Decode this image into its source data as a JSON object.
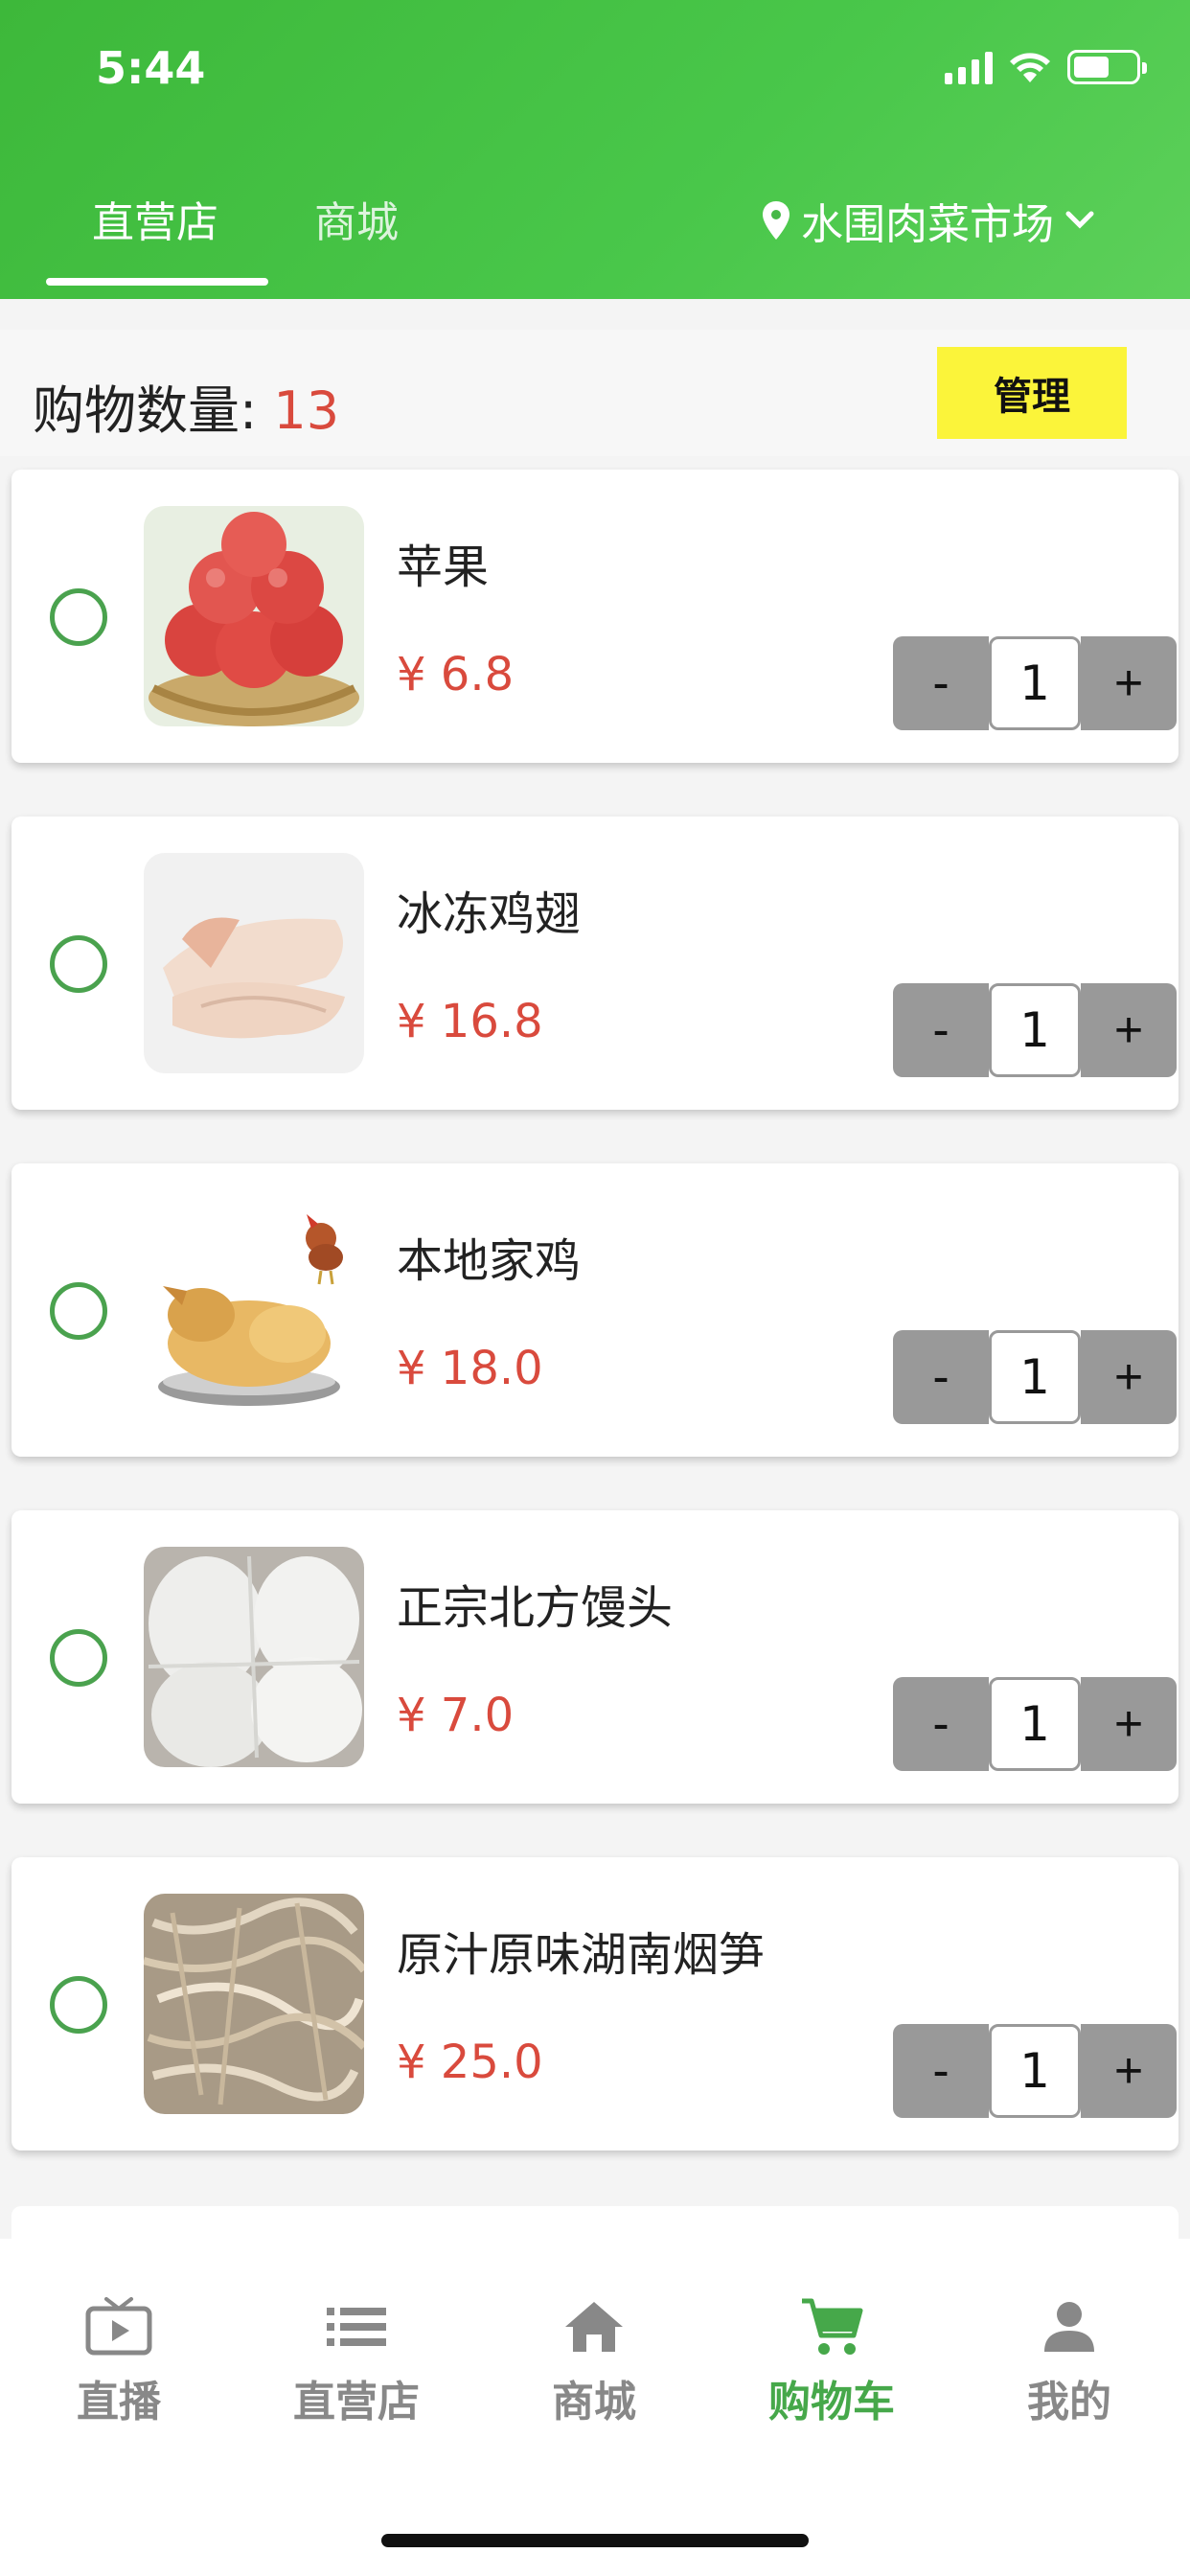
{
  "status_bar": {
    "time": "5:44"
  },
  "header": {
    "tabs": [
      {
        "label": "直营店",
        "active": true
      },
      {
        "label": "商城",
        "active": false
      }
    ],
    "location": "水围肉菜市场"
  },
  "summary": {
    "label": "购物数量: ",
    "count": "13",
    "manage_label": "管理"
  },
  "cart": {
    "items": [
      {
        "name": "苹果",
        "price": "¥ 6.8",
        "quantity": "1",
        "image": "apples"
      },
      {
        "name": "冰冻鸡翅",
        "price": "¥ 16.8",
        "quantity": "1",
        "image": "chicken-wings"
      },
      {
        "name": "本地家鸡",
        "price": "¥ 18.0",
        "quantity": "1",
        "image": "whole-chicken"
      },
      {
        "name": "正宗北方馒头",
        "price": "¥ 7.0",
        "quantity": "1",
        "image": "steamed-buns"
      },
      {
        "name": "原汁原味湖南烟笋",
        "price": "¥ 25.0",
        "quantity": "1",
        "image": "dried-bamboo-shoots"
      }
    ],
    "minus_label": "-",
    "plus_label": "+"
  },
  "bottom_nav": {
    "items": [
      {
        "label": "直播",
        "icon": "tv-icon"
      },
      {
        "label": "直营店",
        "icon": "list-icon"
      },
      {
        "label": "商城",
        "icon": "home-icon"
      },
      {
        "label": "购物车",
        "icon": "cart-icon",
        "active": true
      },
      {
        "label": "我的",
        "icon": "person-icon"
      }
    ]
  },
  "colors": {
    "brand_green": "#46b847",
    "price_red": "#d94a3d",
    "manage_yellow": "#fbf43a"
  }
}
